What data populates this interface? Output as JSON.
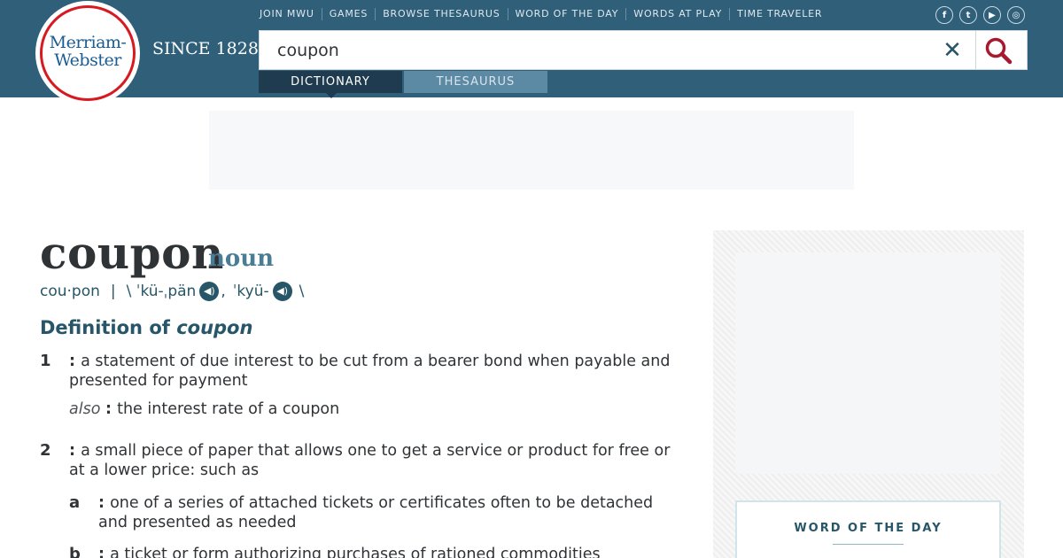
{
  "brand": {
    "logo_line1": "Merriam-",
    "logo_line2": "Webster",
    "since": "SINCE 1828"
  },
  "topnav": [
    "JOIN MWU",
    "GAMES",
    "BROWSE THESAURUS",
    "WORD OF THE DAY",
    "WORDS AT PLAY",
    "TIME TRAVELER"
  ],
  "social": [
    {
      "icon": "facebook-icon",
      "glyph": "f"
    },
    {
      "icon": "twitter-icon",
      "glyph": "t"
    },
    {
      "icon": "youtube-icon",
      "glyph": "▶"
    },
    {
      "icon": "instagram-icon",
      "glyph": "◎"
    }
  ],
  "search": {
    "value": "coupon",
    "clear_glyph": "✕"
  },
  "tabs": {
    "dictionary": "DICTIONARY",
    "thesaurus": "THESAURUS"
  },
  "entry": {
    "headword": "coupon",
    "pos": "noun",
    "syllables": "cou·pon",
    "divider": "|",
    "pron1": "\\ ˈkü-ˌpän",
    "comma": ",",
    "pron2": "ˈkyü-",
    "pron_end": "\\",
    "def_title_prefix": "Definition of ",
    "def_title_word": "coupon"
  },
  "senses": {
    "s1_num": "1",
    "s1_text": "a statement of due interest to be cut from a bearer bond when payable and presented for payment",
    "s1_also_label": "also",
    "s1_also_text": "the interest rate of a coupon",
    "s2_num": "2",
    "s2_text": "a small piece of paper that allows one to get a service or product for free or at a lower price: such as",
    "s2a_letter": "a",
    "s2a_text": "one of a series of attached tickets or certificates often to be detached and presented as needed",
    "s2b_letter": "b",
    "s2b_text": "a ticket or form authorizing purchases of rationed commodities"
  },
  "sidebar": {
    "wotd_label": "WORD OF THE DAY"
  },
  "colors": {
    "header": "#305f7a",
    "accent": "#265667",
    "logo_red": "#d71920"
  }
}
